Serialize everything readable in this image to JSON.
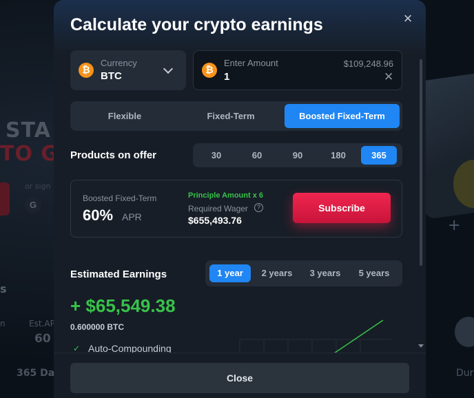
{
  "background": {
    "hero_line1": "STA",
    "hero_line2": "TO G",
    "sign_in_text": "or sign",
    "google_letter": "G",
    "section_letter": "s",
    "col_fragment": "n",
    "est_apr_label": "Est.AP",
    "apr_fragment": "60",
    "days_fragment": "365 Day",
    "duration_fragment": "Dur",
    "plus_glyph": "+"
  },
  "modal": {
    "title": "Calculate your crypto earnings",
    "close_icon": "×",
    "currency": {
      "label": "Currency",
      "value": "BTC",
      "icon": "₿"
    },
    "amount": {
      "label": "Enter Amount",
      "value": "1",
      "usd_value": "$109,248.96",
      "clear_icon": "✕",
      "icon": "₿"
    },
    "product_tabs": [
      {
        "label": "Flexible",
        "active": false
      },
      {
        "label": "Fixed-Term",
        "active": false
      },
      {
        "label": "Boosted Fixed-Term",
        "active": true
      }
    ],
    "products_label": "Products on offer",
    "day_tabs": [
      {
        "label": "30",
        "active": false
      },
      {
        "label": "60",
        "active": false
      },
      {
        "label": "90",
        "active": false
      },
      {
        "label": "180",
        "active": false
      },
      {
        "label": "365",
        "active": true
      }
    ],
    "offer": {
      "type_label": "Boosted Fixed-Term",
      "apr_value": "60%",
      "apr_unit": "APR",
      "principle_text": "Principle Amount x 6",
      "required_wager_label": "Required Wager",
      "info_icon": "?",
      "required_wager_value": "$655,493.76",
      "subscribe_label": "Subscribe"
    },
    "earnings": {
      "label": "Estimated Earnings",
      "year_tabs": [
        {
          "label": "1 year",
          "active": true
        },
        {
          "label": "2 years",
          "active": false
        },
        {
          "label": "3 years",
          "active": false
        },
        {
          "label": "5 years",
          "active": false
        }
      ],
      "amount": "+ $65,549.38",
      "btc_amount": "0.600000 BTC",
      "check_icon": "✓",
      "auto_compounding_label": "Auto-Compounding"
    },
    "footer": {
      "close_label": "Close"
    },
    "colors": {
      "accent_blue": "#2086f3",
      "subscribe_red": "#e61e46",
      "earnings_green": "#38c24a",
      "bitcoin_orange": "#f7931a"
    }
  }
}
